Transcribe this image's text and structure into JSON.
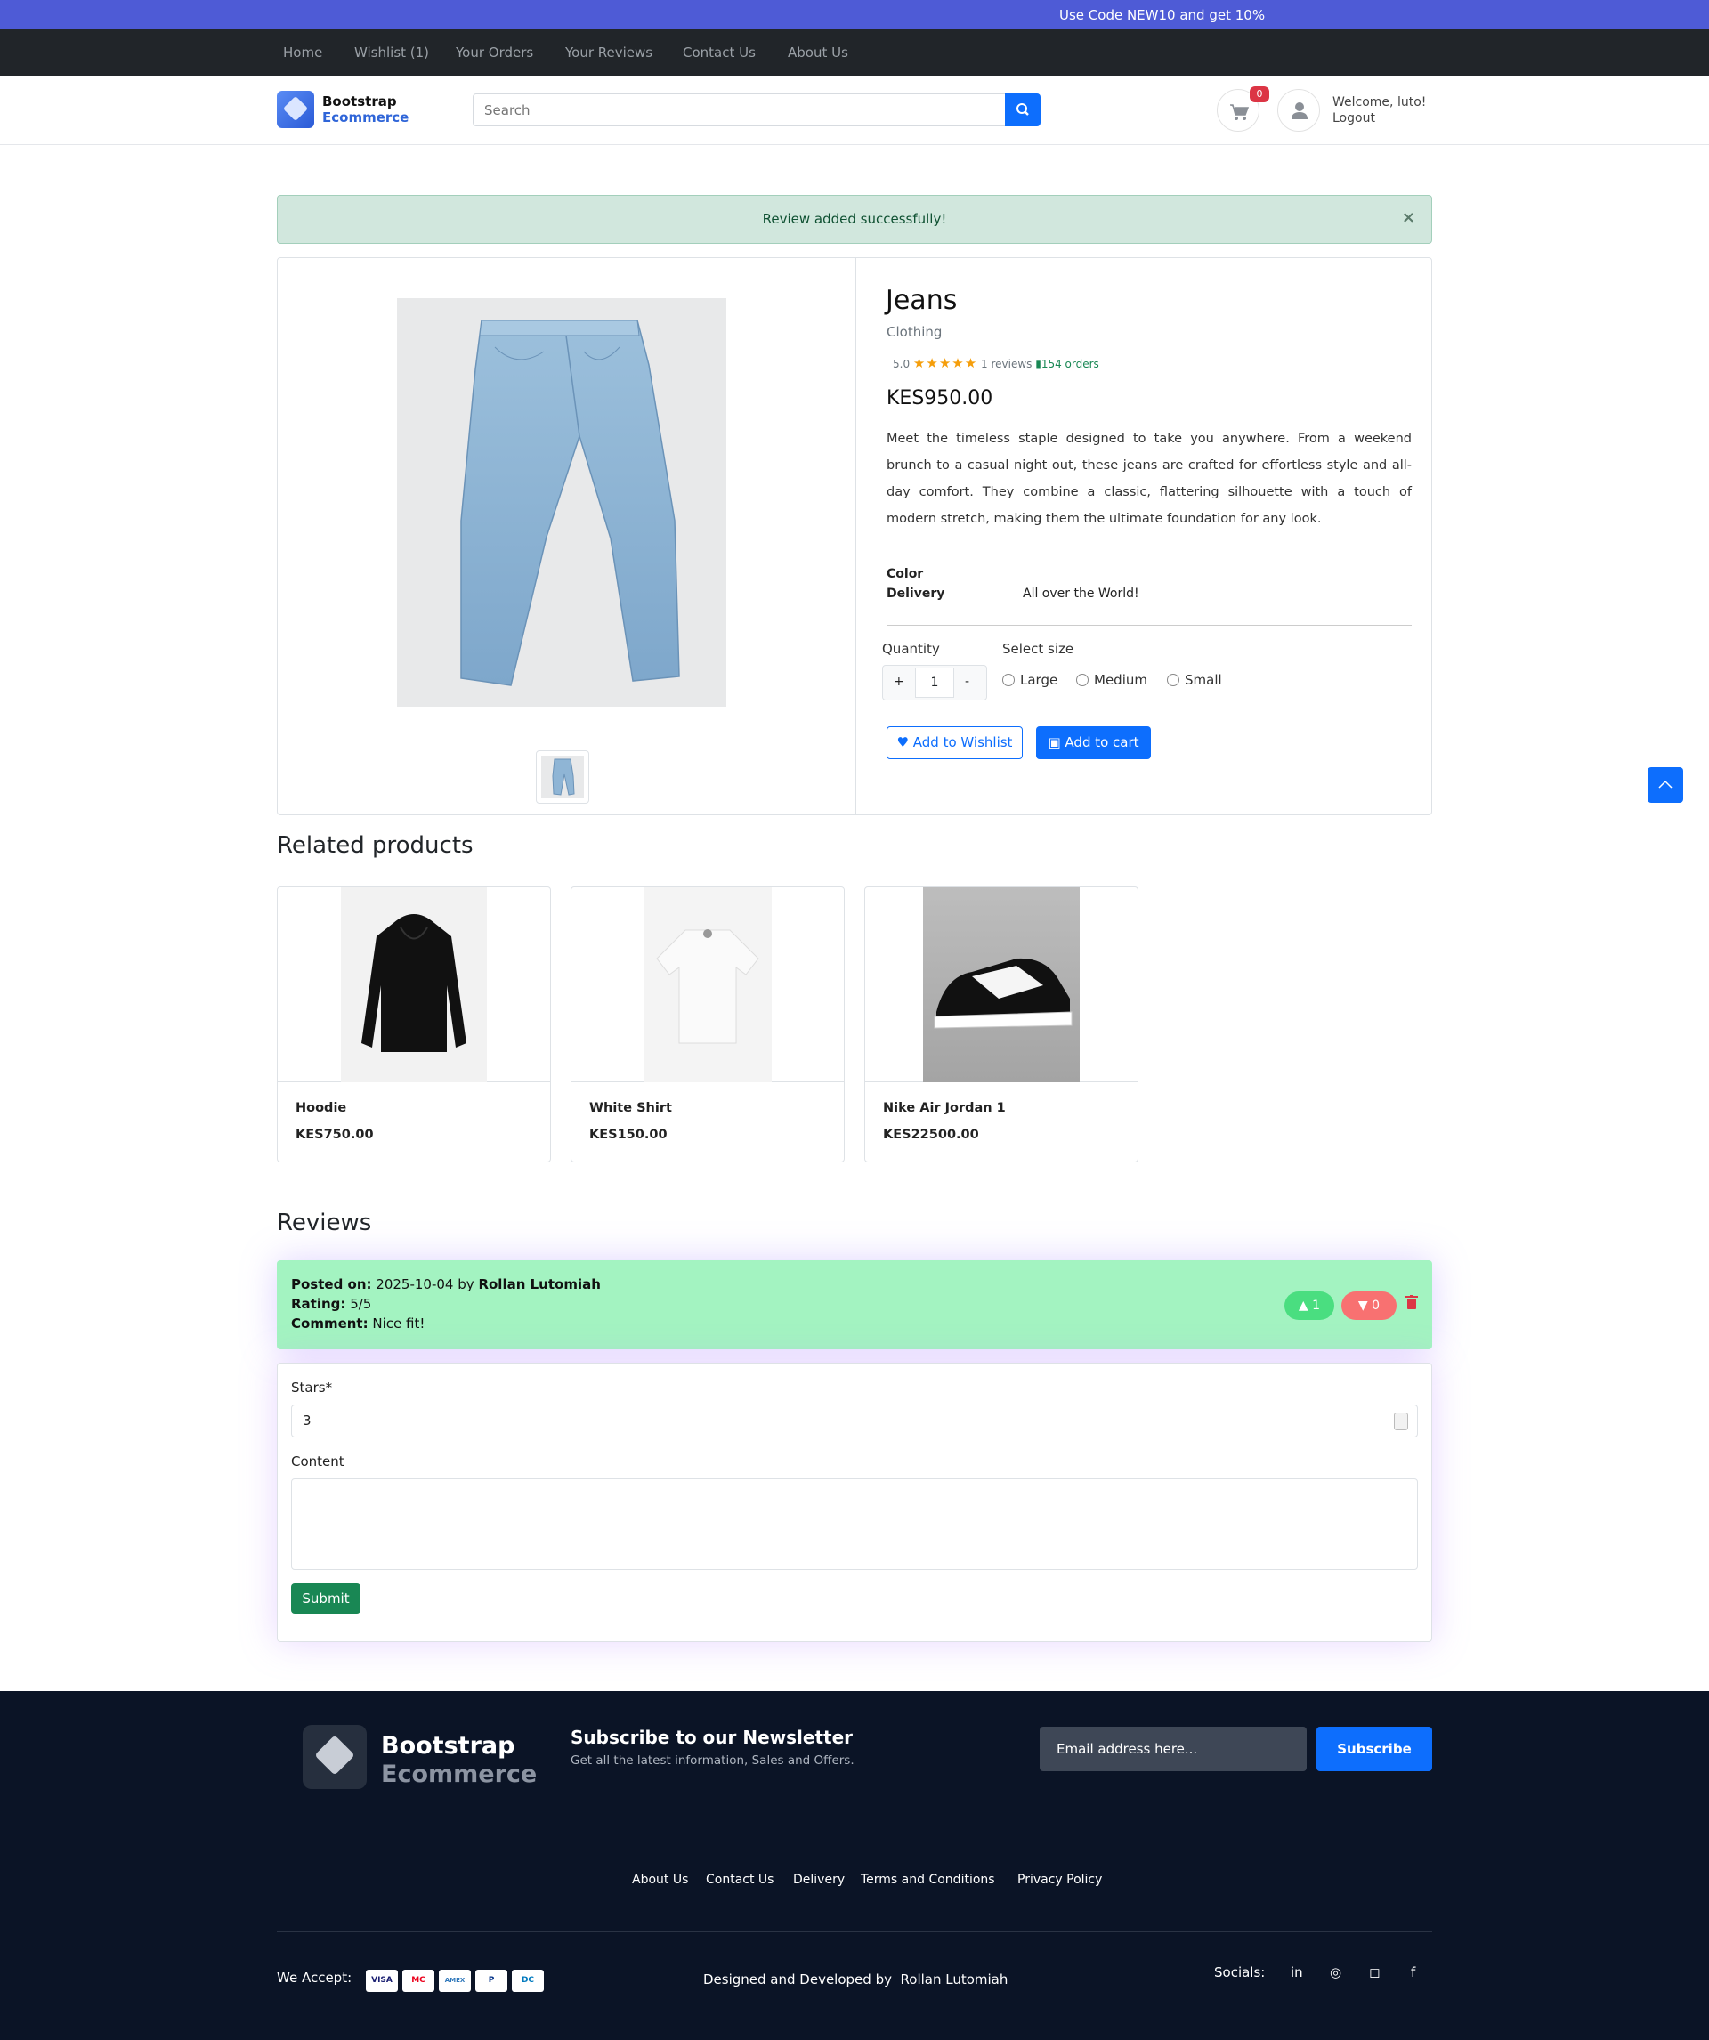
{
  "promo": "Use Code NEW10 and get 10%",
  "nav": [
    "Home",
    "Wishlist (1)",
    "Your Orders",
    "Your Reviews",
    "Contact Us",
    "About Us"
  ],
  "brand": {
    "line1": "Bootstrap",
    "line2": "Ecommerce"
  },
  "search": {
    "placeholder": "Search"
  },
  "cart_count": "0",
  "user": {
    "welcome": "Welcome, luto!",
    "logout": "Logout"
  },
  "alert": {
    "message": "Review added successfully!",
    "close": "×"
  },
  "product": {
    "name": "Jeans",
    "category": "Clothing",
    "rating": "5.0",
    "stars": "★★★★★",
    "reviews": "1 reviews",
    "orders": "154 orders",
    "price": "KES950.00",
    "description": "Meet the timeless staple designed to take you anywhere. From a weekend brunch to a casual night out, these jeans are crafted for effortless style and all-day comfort. They combine a classic, flattering silhouette with a touch of modern stretch, making them the ultimate foundation for any look.",
    "color_label": "Color",
    "delivery_label": "Delivery",
    "delivery_value": "All over the World!",
    "quantity_label": "Quantity",
    "quantity": "1",
    "plus": "+",
    "minus": "-",
    "size_label": "Select size",
    "sizes": [
      "Large",
      "Medium",
      "Small"
    ],
    "wishlist_btn": "Add to Wishlist",
    "cart_btn": "Add to cart"
  },
  "related": {
    "title": "Related products",
    "items": [
      {
        "name": "Hoodie",
        "price": "KES750.00"
      },
      {
        "name": "White Shirt",
        "price": "KES150.00"
      },
      {
        "name": "Nike Air Jordan 1",
        "price": "KES22500.00"
      }
    ]
  },
  "reviews": {
    "title": "Reviews",
    "item": {
      "posted_label": "Posted on:",
      "date": "2025-10-04",
      "by": "by",
      "author": "Rollan Lutomiah",
      "rating_label": "Rating:",
      "rating": "5/5",
      "comment_label": "Comment:",
      "comment": "Nice fit!",
      "likes": "1",
      "dislikes": "0"
    }
  },
  "review_form": {
    "stars_label": "Stars*",
    "stars_value": "3",
    "content_label": "Content",
    "submit": "Submit"
  },
  "footer": {
    "brand1": "Bootstrap",
    "brand2": "Ecommerce",
    "newsletter_title": "Subscribe to our Newsletter",
    "newsletter_sub": "Get all the latest information, Sales and Offers.",
    "email_placeholder": "Email address here...",
    "subscribe": "Subscribe",
    "links": [
      "About Us",
      "Contact Us",
      "Delivery",
      "Terms and Conditions",
      "Privacy Policy"
    ],
    "we_accept": "We Accept:",
    "credit_label": "Designed and Developed by",
    "credit_name": "Rollan Lutomiah",
    "socials": "Socials:",
    "payments": [
      "VISA",
      "MC",
      "AMEX",
      "P",
      "DC"
    ]
  },
  "colors": {
    "primary": "#0d6efd",
    "promo_bg": "#4e5bd6",
    "nav_bg": "#212529",
    "footer_bg": "#0b1426",
    "review_bg": "#a3f3c1"
  }
}
